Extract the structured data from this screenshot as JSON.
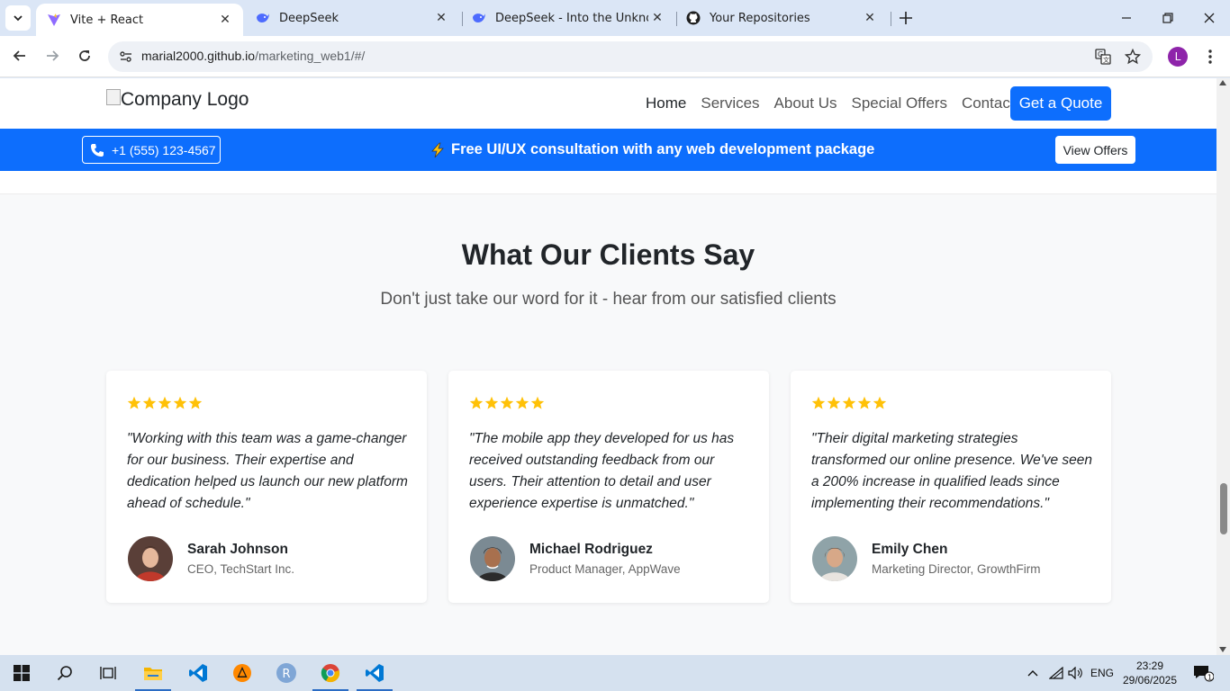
{
  "browser": {
    "tabs": [
      {
        "title": "Vite + React",
        "active": true,
        "icon": "vite-icon"
      },
      {
        "title": "DeepSeek",
        "active": false,
        "icon": "deepseek-icon"
      },
      {
        "title": "DeepSeek - Into the Unknown",
        "active": false,
        "icon": "deepseek-icon"
      },
      {
        "title": "Your Repositories",
        "active": false,
        "icon": "github-icon"
      }
    ],
    "url_host": "marial2000.github.io",
    "url_path": "/marketing_web1/#/",
    "profile_initial": "L"
  },
  "site": {
    "logo_alt": "Company Logo",
    "nav": [
      "Home",
      "Services",
      "About Us",
      "Special Offers",
      "Contact"
    ],
    "active_nav": "Home",
    "cta": "Get a Quote",
    "phone": "+1 (555) 123-4567",
    "promo": "Free UI/UX consultation with any web development package",
    "offers_button": "View Offers"
  },
  "testimonials": {
    "title": "What Our Clients Say",
    "subtitle": "Don't just take our word for it - hear from our satisfied clients",
    "items": [
      {
        "rating": 5,
        "quote": "\"Working with this team was a game-changer for our business. Their expertise and dedication helped us launch our new platform ahead of schedule.\"",
        "name": "Sarah Johnson",
        "role": "CEO, TechStart Inc."
      },
      {
        "rating": 5,
        "quote": "\"The mobile app they developed for us has received outstanding feedback from our users. Their attention to detail and user experience expertise is unmatched.\"",
        "name": "Michael Rodriguez",
        "role": "Product Manager, AppWave"
      },
      {
        "rating": 5,
        "quote": "\"Their digital marketing strategies transformed our online presence. We've seen a 200% increase in qualified leads since implementing their recommendations.\"",
        "name": "Emily Chen",
        "role": "Marketing Director, GrowthFirm"
      }
    ]
  },
  "taskbar": {
    "language": "ENG",
    "time": "23:29",
    "date": "29/06/2025",
    "notifications": "1"
  },
  "colors": {
    "primary": "#0d6efd",
    "star": "#ffc107",
    "tabstrip": "#dbe6f6"
  }
}
